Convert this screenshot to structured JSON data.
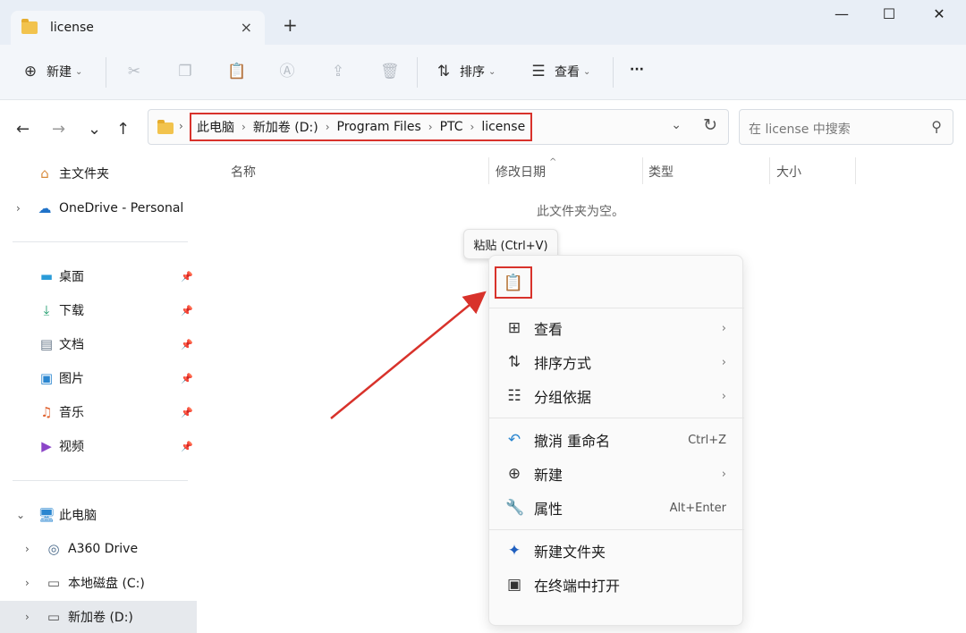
{
  "tab": {
    "title": "license",
    "close": "×",
    "new": "+"
  },
  "window": {
    "minimize": "—",
    "maximize": "☐",
    "close": "✕"
  },
  "toolbar": {
    "new_label": "新建",
    "sort_label": "排序",
    "view_label": "查看",
    "more_label": "···"
  },
  "nav": {
    "back": "←",
    "forward": "→",
    "recent": "⌄",
    "up": "↑"
  },
  "address": {
    "crumbs": [
      "此电脑",
      "新加卷 (D:)",
      "Program Files",
      "PTC",
      "license"
    ],
    "separator": "›"
  },
  "search": {
    "placeholder": "在 license 中搜索"
  },
  "sidebar": {
    "home": "主文件夹",
    "onedrive": "OneDrive - Personal",
    "quick": [
      "桌面",
      "下载",
      "文档",
      "图片",
      "音乐",
      "视频"
    ],
    "thispc": "此电脑",
    "drives": [
      "A360 Drive",
      "本地磁盘 (C:)",
      "新加卷 (D:)"
    ]
  },
  "columns": {
    "name": "名称",
    "modified": "修改日期",
    "type": "类型",
    "size": "大小"
  },
  "empty_message": "此文件夹为空。",
  "tooltip": "粘贴 (Ctrl+V)",
  "context_menu": {
    "view": "查看",
    "sort": "排序方式",
    "group": "分组依据",
    "undo": "撤消 重命名",
    "undo_shortcut": "Ctrl+Z",
    "new": "新建",
    "properties": "属性",
    "properties_shortcut": "Alt+Enter",
    "new_folder": "新建文件夹",
    "open_terminal": "在终端中打开"
  },
  "colors": {
    "highlight": "#d8322b",
    "accent": "#3a78c8"
  }
}
